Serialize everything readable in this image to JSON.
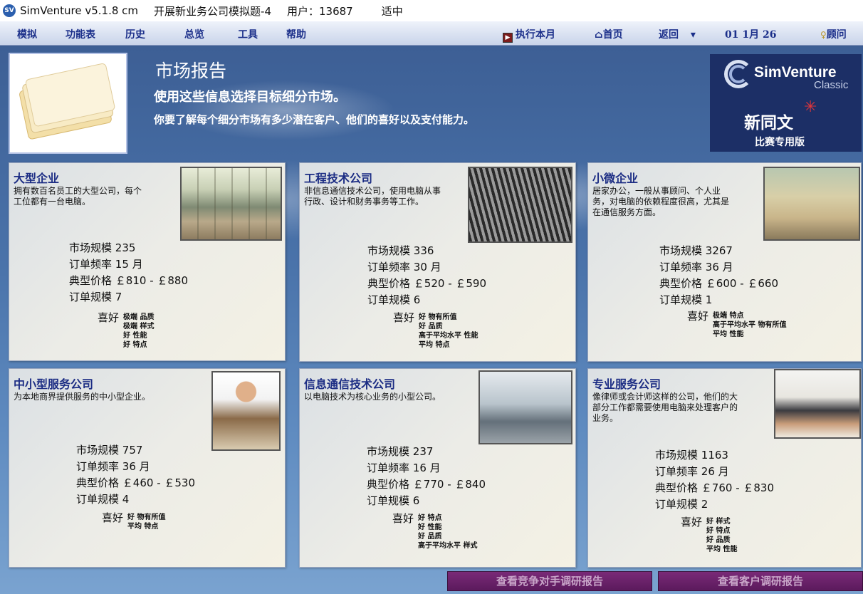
{
  "titlebar": {
    "app_icon": "SV",
    "app_name": "SimVenture v5.1.8 cm",
    "scenario": "开展新业务公司模拟题-4",
    "user": "用户：13687",
    "size": "适中"
  },
  "menu": {
    "items": [
      "模拟",
      "功能表",
      "历史",
      "总览",
      "工具",
      "帮助"
    ],
    "run_month": "执行本月",
    "home": "首页",
    "back": "返回",
    "date": "01 1月 26",
    "advisor": "顾问"
  },
  "header": {
    "title": "市场报告",
    "subtitle": "使用这些信息选择目标细分市场。",
    "description": "你要了解每个细分市场有多少潜在客户、他们的喜好以及支付能力。"
  },
  "logo": {
    "brand": "SimVenture",
    "classic": "Classic",
    "partner": "新同文",
    "edition": "比赛专用版"
  },
  "labels": {
    "market_size": "市场规模",
    "order_freq": "订单频率",
    "typical_price": "典型价格",
    "order_size": "订单规模",
    "preferences": "喜好"
  },
  "segments": [
    {
      "name": "大型企业",
      "desc_lines": [
        "拥有数百名员工的大型公司，每个",
        "工位都有一台电脑。"
      ],
      "market_size": "235",
      "order_freq": "15 月",
      "price": "￡810 - ￡880",
      "order_size": "7",
      "prefs": [
        "极端 品质",
        "极端 样式",
        "好 性能",
        "好 特点"
      ]
    },
    {
      "name": "工程技术公司",
      "desc_lines": [
        "非信息通信技术公司，使用电脑从事",
        "行政、设计和财务事务等工作。"
      ],
      "market_size": "336",
      "order_freq": "30 月",
      "price": "￡520 - ￡590",
      "order_size": "6",
      "prefs": [
        "好 物有所值",
        "好 品质",
        "高于平均水平 性能",
        "平均 特点"
      ]
    },
    {
      "name": "小微企业",
      "desc_lines": [
        "居家办公，一般从事顾问、个人业",
        "务，对电脑的依赖程度很高，尤其是",
        "在通信服务方面。"
      ],
      "market_size": "3267",
      "order_freq": "36 月",
      "price": "￡600 - ￡660",
      "order_size": "1",
      "prefs": [
        "极端 特点",
        "高于平均水平 物有所值",
        "平均 性能"
      ]
    },
    {
      "name": "中小型服务公司",
      "desc_lines": [
        "为本地商界提供服务的中小型企业。"
      ],
      "market_size": "757",
      "order_freq": "36 月",
      "price": "￡460 - ￡530",
      "order_size": "4",
      "prefs": [
        "好 物有所值",
        "平均 特点"
      ]
    },
    {
      "name": "信息通信技术公司",
      "desc_lines": [
        "以电脑技术为核心业务的小型公司。"
      ],
      "market_size": "237",
      "order_freq": "16 月",
      "price": "￡770 - ￡840",
      "order_size": "6",
      "prefs": [
        "好 特点",
        "好 性能",
        "好 品质",
        "高于平均水平 样式"
      ]
    },
    {
      "name": "专业服务公司",
      "desc_lines": [
        "像律师或会计师这样的公司，他们的大",
        "部分工作都需要使用电脑来处理客户的",
        "业务。"
      ],
      "market_size": "1163",
      "order_freq": "26 月",
      "price": "￡760 - ￡830",
      "order_size": "2",
      "prefs": [
        "好 样式",
        "好 特点",
        "好 品质",
        "平均 性能"
      ]
    }
  ],
  "buttons": {
    "competitor_report": "查看竞争对手调研报告",
    "customer_report": "查看客户调研报告"
  }
}
